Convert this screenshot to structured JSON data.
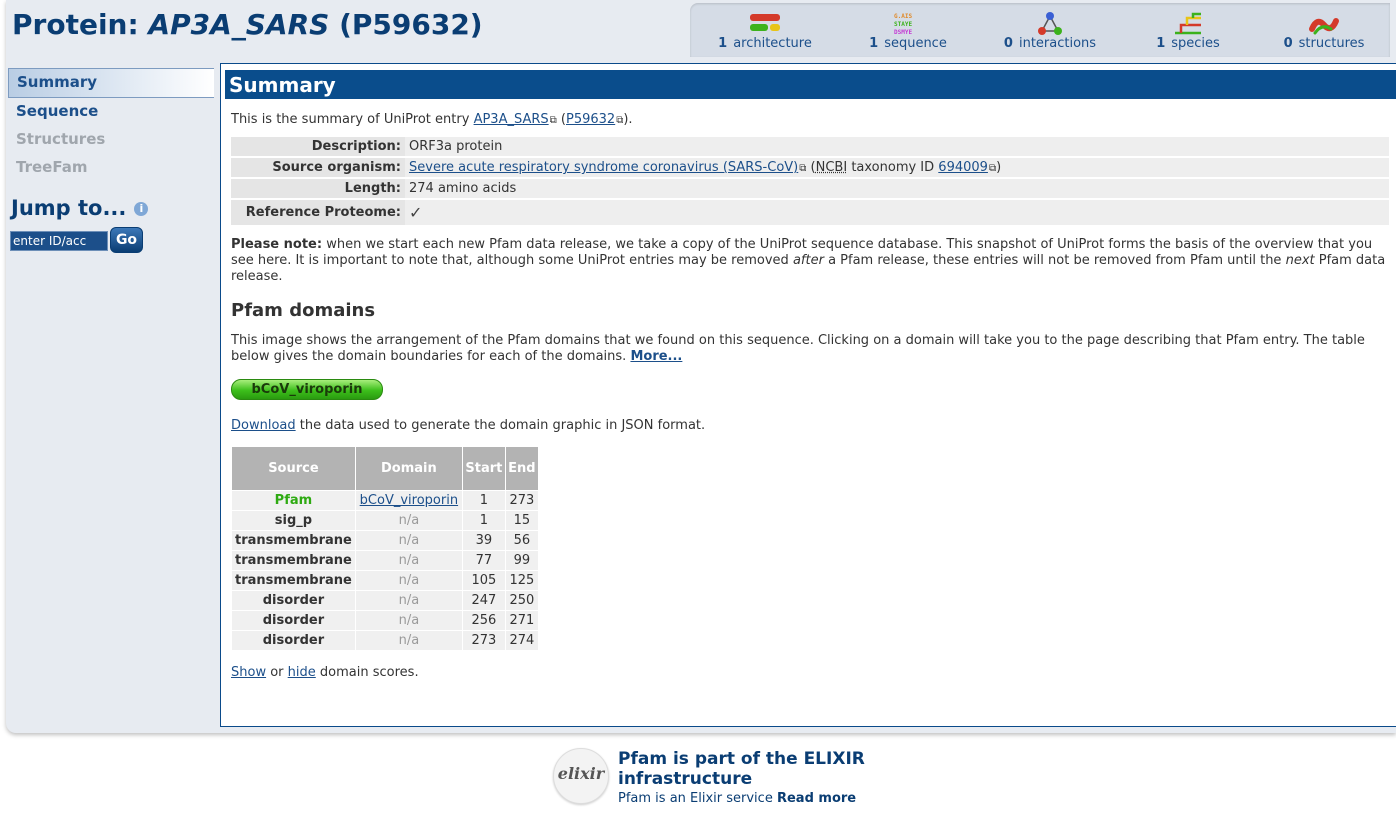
{
  "header": {
    "prefix": "Protein:",
    "name": "AP3A_SARS",
    "accession": "(P59632)"
  },
  "stats": [
    {
      "count": "1",
      "label": "architecture",
      "icon": "architecture-icon"
    },
    {
      "count": "1",
      "label": "sequence",
      "icon": "sequence-icon"
    },
    {
      "count": "0",
      "label": "interactions",
      "icon": "interactions-icon"
    },
    {
      "count": "1",
      "label": "species",
      "icon": "species-icon"
    },
    {
      "count": "0",
      "label": "structures",
      "icon": "structures-icon"
    }
  ],
  "sidebar": {
    "items": [
      {
        "label": "Summary",
        "state": "active"
      },
      {
        "label": "Sequence",
        "state": "enabled"
      },
      {
        "label": "Structures",
        "state": "disabled"
      },
      {
        "label": "TreeFam",
        "state": "disabled"
      }
    ],
    "jump_label": "Jump to...",
    "jump_value": "enter ID/acc",
    "go_label": "Go"
  },
  "summary": {
    "heading": "Summary",
    "intro_pre": "This is the summary of UniProt entry",
    "entry_link": "AP3A_SARS",
    "accession_link": "P59632",
    "intro_post": ").",
    "description_key": "Description:",
    "description_value": "ORF3a protein",
    "organism_key": "Source organism:",
    "organism_link": "Severe acute respiratory syndrome coronavirus (SARS-CoV)",
    "ncbi_abbr": "NCBI",
    "taxonomy_text": "taxonomy ID",
    "taxonomy_id": "694009",
    "length_key": "Length:",
    "length_value": "274 amino acids",
    "proteome_key": "Reference Proteome:",
    "proteome_value": "✓",
    "note_bold": "Please note:",
    "note_1": "when we start each new Pfam data release, we take a copy of the UniProt sequence database. This snapshot of UniProt forms the basis of the overview that you see here. It is important to note that, although some UniProt entries may be removed",
    "note_after": "after",
    "note_2": "a Pfam release, these entries will not be removed from Pfam until the",
    "note_next": "next",
    "note_3": "Pfam data release."
  },
  "domains": {
    "heading": "Pfam domains",
    "desc": "This image shows the arrangement of the Pfam domains that we found on this sequence. Clicking on a domain will take you to the page describing that Pfam entry. The table below gives the domain boundaries for each of the domains.",
    "more": "More...",
    "graphic_label": "bCoV_viroporin",
    "download_link": "Download",
    "download_text": "the data used to generate the domain graphic in JSON format.",
    "columns": [
      "Source",
      "Domain",
      "Start",
      "End"
    ],
    "rows": [
      {
        "source": "Pfam",
        "domain": "bCoV_viroporin",
        "start": "1",
        "end": "273"
      },
      {
        "source": "sig_p",
        "domain": "n/a",
        "start": "1",
        "end": "15"
      },
      {
        "source": "transmembrane",
        "domain": "n/a",
        "start": "39",
        "end": "56"
      },
      {
        "source": "transmembrane",
        "domain": "n/a",
        "start": "77",
        "end": "99"
      },
      {
        "source": "transmembrane",
        "domain": "n/a",
        "start": "105",
        "end": "125"
      },
      {
        "source": "disorder",
        "domain": "n/a",
        "start": "247",
        "end": "250"
      },
      {
        "source": "disorder",
        "domain": "n/a",
        "start": "256",
        "end": "271"
      },
      {
        "source": "disorder",
        "domain": "n/a",
        "start": "273",
        "end": "274"
      }
    ],
    "show_link": "Show",
    "or_text": "or",
    "hide_link": "hide",
    "scores_text": "domain scores."
  },
  "footer": {
    "logo_text": "elixir",
    "title": "Pfam is part of the ELIXIR infrastructure",
    "service_text": "Pfam is an Elixir service",
    "read_more": "Read more"
  },
  "colors": {
    "brand": "#0a3d73",
    "summary_bar": "#0a4d8c",
    "pfam_green": "#2eaa12"
  }
}
